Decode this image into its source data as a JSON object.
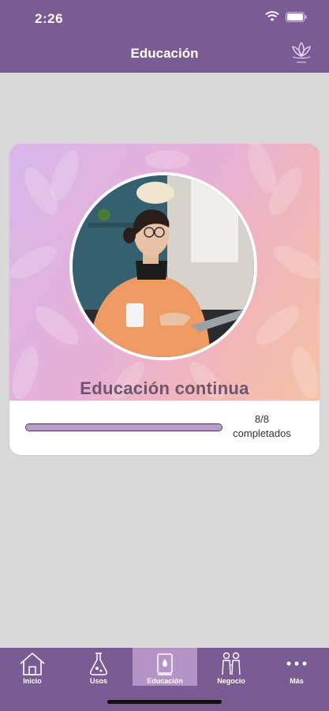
{
  "status_bar": {
    "time": "2:26"
  },
  "header": {
    "title": "Educación",
    "logo_icon": "lotus-logo-icon"
  },
  "course_card": {
    "title": "Educación continua",
    "progress_fraction": 1.0,
    "progress_count": "8/8",
    "progress_label": "completados"
  },
  "tabbar": {
    "tabs": [
      {
        "label": "Inicio",
        "icon": "home-icon",
        "active": false
      },
      {
        "label": "Usos",
        "icon": "flask-icon",
        "active": false
      },
      {
        "label": "Educación",
        "icon": "book-drop-icon",
        "active": true
      },
      {
        "label": "Negocio",
        "icon": "people-icon",
        "active": false
      },
      {
        "label": "Más",
        "icon": "more-icon",
        "active": false
      }
    ]
  },
  "colors": {
    "brand": "#7b5b93",
    "active_tab": "#b593c7",
    "progress": "#b99ccb"
  }
}
